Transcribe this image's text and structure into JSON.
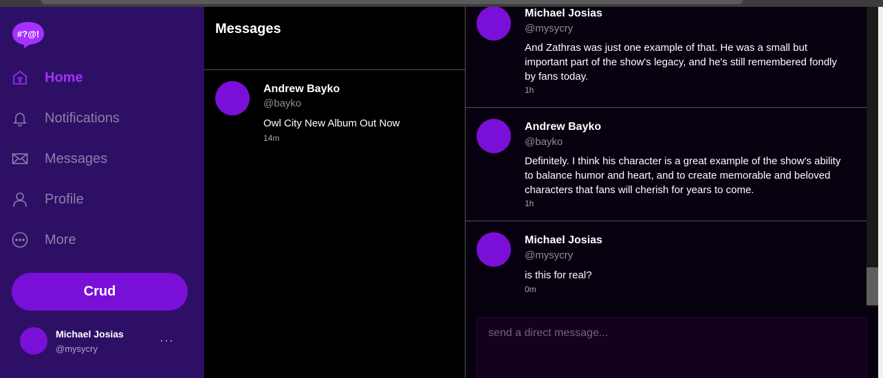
{
  "logo": {
    "text": "#?@!",
    "color": "#a630ff"
  },
  "sidebar": {
    "background": "#2e0f66",
    "items": [
      {
        "label": "Home",
        "icon": "home-icon",
        "active": true
      },
      {
        "label": "Notifications",
        "icon": "bell-icon",
        "active": false
      },
      {
        "label": "Messages",
        "icon": "mail-icon",
        "active": false
      },
      {
        "label": "Profile",
        "icon": "user-icon",
        "active": false
      },
      {
        "label": "More",
        "icon": "more-circle-icon",
        "active": false
      }
    ],
    "crud_button": "Crud",
    "user": {
      "name": "Michael Josias",
      "handle": "@mysycry",
      "menu": "···"
    }
  },
  "messages_panel": {
    "title": "Messages",
    "conversations": [
      {
        "name": "Andrew Bayko",
        "handle": "@bayko",
        "preview": "Owl City New Album Out Now",
        "time": "14m"
      }
    ]
  },
  "thread": {
    "messages": [
      {
        "name": "Michael Josias",
        "handle": "@mysycry",
        "text": "And Zathras was just one example of that. He was a small but important part of the show's legacy, and he's still remembered fondly by fans today.",
        "time": "1h"
      },
      {
        "name": "Andrew Bayko",
        "handle": "@bayko",
        "text": "Definitely. I think his character is a great example of the show's ability to balance humor and heart, and to create memorable and beloved characters that fans will cherish for years to come.",
        "time": "1h"
      },
      {
        "name": "Michael Josias",
        "handle": "@mysycry",
        "text": "is this for real?",
        "time": "0m"
      }
    ],
    "input_placeholder": "send a direct message..."
  },
  "colors": {
    "accent": "#7a0fd8",
    "active_nav": "#a630ff"
  }
}
